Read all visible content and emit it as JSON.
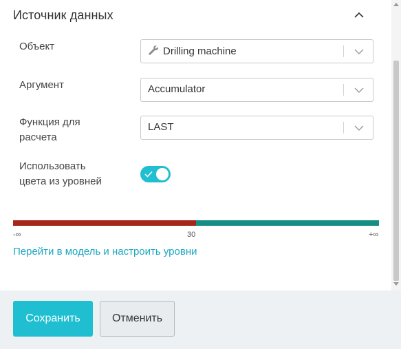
{
  "section": {
    "title": "Источник данных",
    "collapse_icon": "chevron-up-icon"
  },
  "fields": {
    "object": {
      "label": "Объект",
      "value": "Drilling machine",
      "icon": "wrench-icon"
    },
    "argument": {
      "label": "Аргумент",
      "value": "Accumulator"
    },
    "function": {
      "label_line1": "Функция для",
      "label_line2": "расчета",
      "value": "LAST"
    },
    "use_level_colors": {
      "label_line1": "Использовать",
      "label_line2": "цвета из уровней",
      "enabled": true
    }
  },
  "levels": {
    "ticks": [
      "-∞",
      "30",
      "+∞"
    ],
    "segments": [
      {
        "from": "-∞",
        "to": "30",
        "color": "#a5261a",
        "fraction": 0.5
      },
      {
        "from": "30",
        "to": "+∞",
        "color": "#168e86",
        "fraction": 0.5
      }
    ]
  },
  "link": {
    "text": "Перейти в модель и настроить уровни"
  },
  "footer": {
    "save_label": "Сохранить",
    "cancel_label": "Отменить"
  },
  "colors": {
    "accent": "#1fbfd1",
    "link": "#1aa6c2"
  }
}
